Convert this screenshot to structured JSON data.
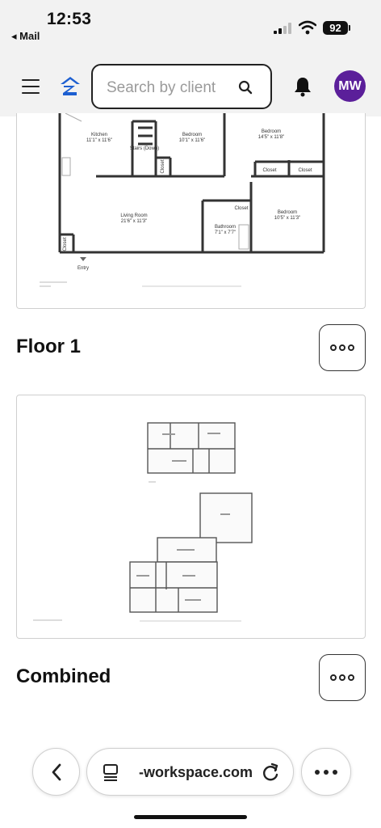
{
  "status": {
    "time": "12:53",
    "back_app": "◂ Mail",
    "battery": "92"
  },
  "header": {
    "search_placeholder": "Search by client",
    "avatar_initials": "MW",
    "brand_color": "#1d5fd1",
    "avatar_color": "#5b1f9a"
  },
  "plans": [
    {
      "title": "Floor 1",
      "rooms": [
        {
          "label": "Kitchen",
          "dim": "11'1\" x 11'6\""
        },
        {
          "label": "Stairs (Down)",
          "dim": ""
        },
        {
          "label": "Bedroom",
          "dim": "10'1\" x 11'6\""
        },
        {
          "label": "Bedroom",
          "dim": "14'5\" x 11'8\""
        },
        {
          "label": "Closet",
          "dim": ""
        },
        {
          "label": "Closet",
          "dim": ""
        },
        {
          "label": "Closet",
          "dim": ""
        },
        {
          "label": "Closet",
          "dim": ""
        },
        {
          "label": "Living Room",
          "dim": "21'6\" x 11'3\""
        },
        {
          "label": "Bathroom",
          "dim": "7'1\" x 7'7\""
        },
        {
          "label": "Bedroom",
          "dim": "10'5\" x 11'3\""
        },
        {
          "label": "Closet",
          "dim": ""
        },
        {
          "label": "Entry",
          "dim": ""
        }
      ]
    },
    {
      "title": "Combined"
    }
  ],
  "browser": {
    "url": "-workspace.com"
  }
}
